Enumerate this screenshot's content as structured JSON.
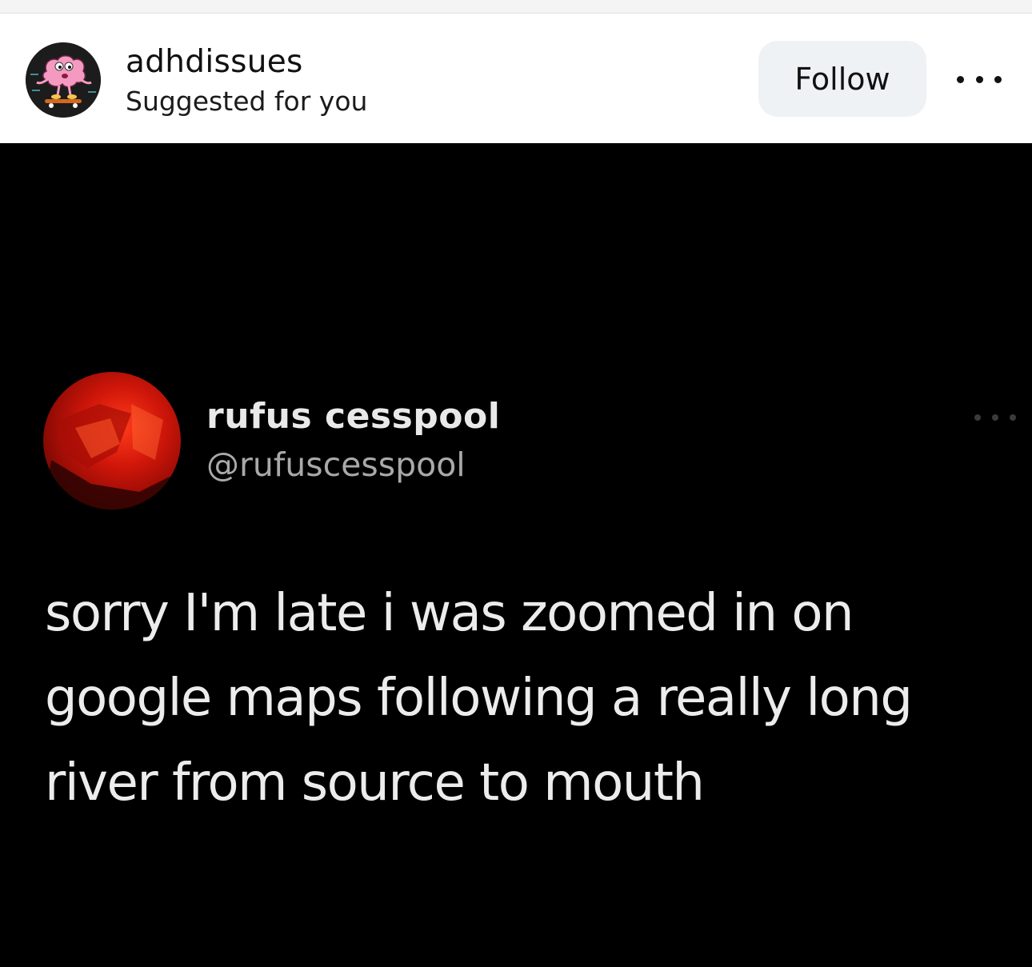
{
  "post": {
    "account": {
      "username": "adhdissues",
      "subtitle": "Suggested for you",
      "avatar_icon": "pink-brain-skateboard-avatar"
    },
    "follow_label": "Follow",
    "more_icon": "more-horizontal-icon"
  },
  "tweet": {
    "display_name": "rufus cesspool",
    "handle": "@rufuscesspool",
    "lines": [
      "sorry I'm late i was zoomed in on",
      "google maps following a really long",
      "river from source to mouth"
    ]
  },
  "colors": {
    "follow_bg": "#eff2f5",
    "image_bg": "#000000",
    "tweet_text": "#ececec",
    "tweet_handle": "#a9a9a9",
    "tweet_avatar_red": "#d0160a"
  }
}
